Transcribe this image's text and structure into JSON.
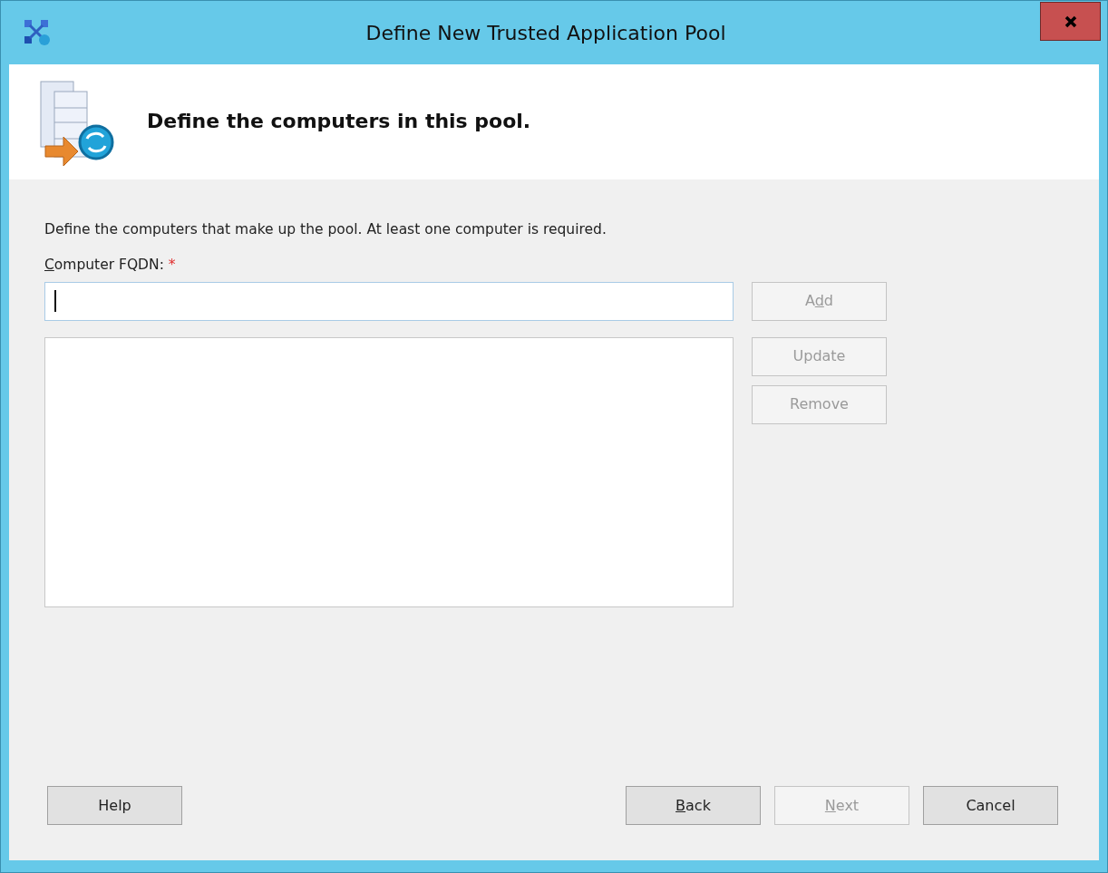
{
  "window": {
    "title": "Define New Trusted Application Pool"
  },
  "header": {
    "title": "Define the computers in this pool."
  },
  "description": "Define the computers that make up the pool. At least one computer is required.",
  "field": {
    "label": {
      "key": "C",
      "after": "omputer FQDN:"
    },
    "required_mark": "*",
    "focused": true
  },
  "side_buttons": [
    {
      "label": {
        "before": "A",
        "key": "d",
        "after": "d"
      },
      "disabled": true
    },
    {
      "label": {
        "before": "Update"
      },
      "disabled": true
    },
    {
      "label": {
        "before": "Remove"
      },
      "disabled": true
    }
  ],
  "footer_left_buttons": [
    {
      "label": {
        "before": "Help"
      },
      "disabled": false
    }
  ],
  "footer_right_buttons": [
    {
      "label": {
        "key": "B",
        "after": "ack"
      },
      "disabled": false
    },
    {
      "label": {
        "key": "N",
        "after": "ext"
      },
      "disabled": true
    },
    {
      "label": {
        "before": "Cancel"
      },
      "disabled": false
    }
  ]
}
